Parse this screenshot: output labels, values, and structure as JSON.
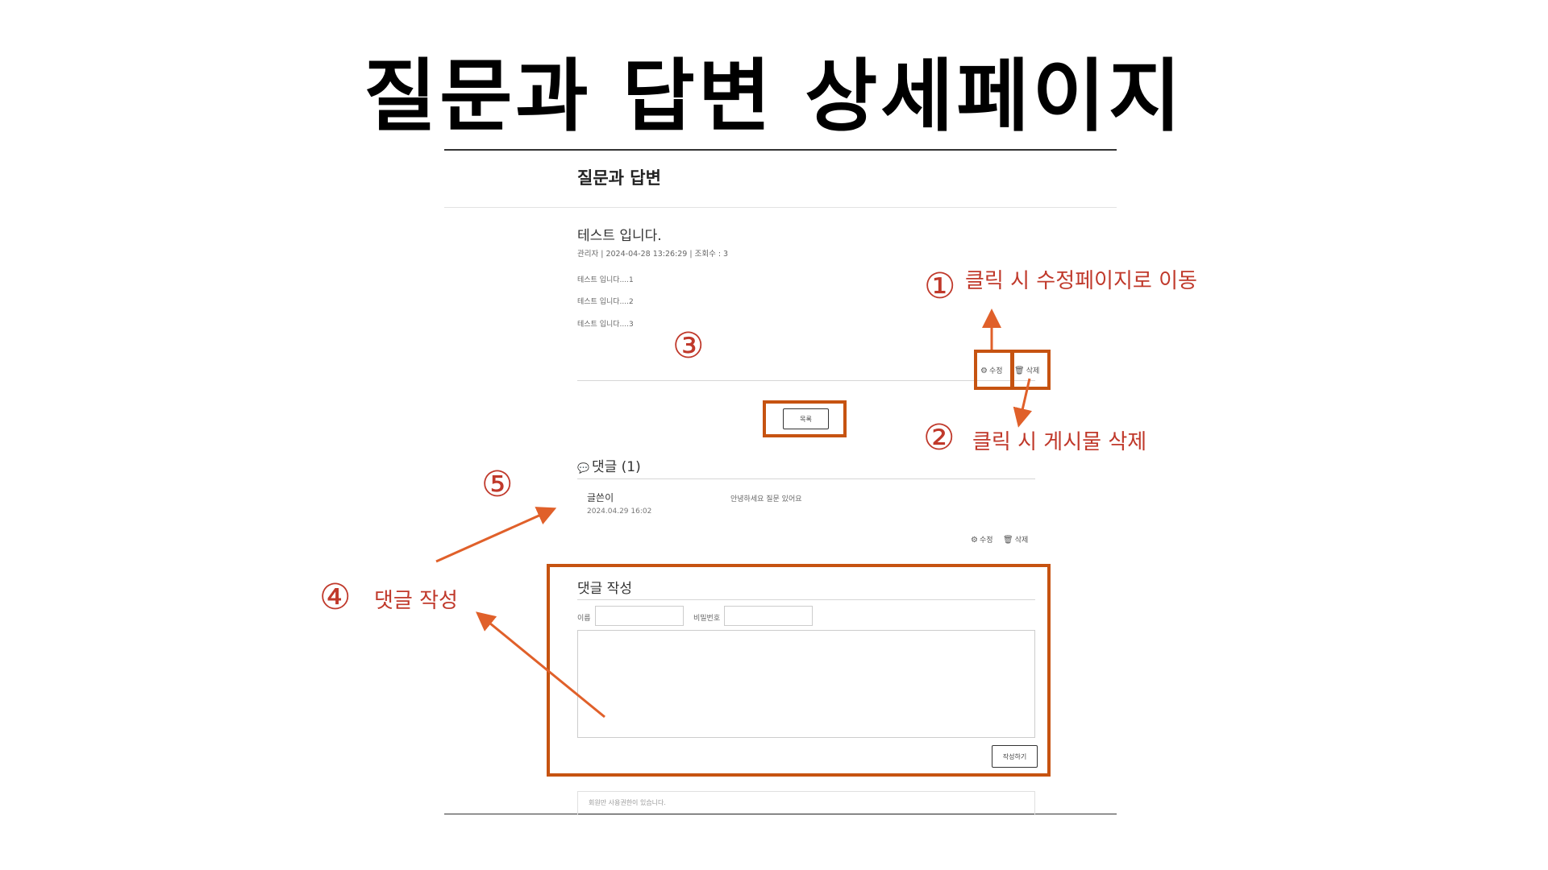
{
  "slide": {
    "title": "질문과 답변 상세페이지"
  },
  "page": {
    "board_title": "질문과 답변",
    "post": {
      "title": "테스트 입니다.",
      "meta": "관리자  |  2024-04-28 13:26:29  |  조회수 :   3",
      "lines": [
        "테스트 입니다....1",
        "테스트 입니다....2",
        "테스트 입니다....3"
      ]
    },
    "actions": {
      "edit_label": "수정",
      "delete_label": "삭제",
      "edit_icon": "gear-icon",
      "delete_icon": "trash-icon"
    },
    "list_button": "목록",
    "comments": {
      "heading": "댓글 (1)",
      "heading_icon": "speech-bubble-icon",
      "items": [
        {
          "author": "글쓴이",
          "date": "2024.04.29 16:02",
          "body": "안녕하세요 질문 있어요",
          "edit_label": "수정",
          "delete_label": "삭제"
        }
      ]
    },
    "comment_form": {
      "heading": "댓글 작성",
      "name_label": "이름",
      "password_label": "비밀번호",
      "submit_label": "작성하기"
    },
    "login_note": "회원만 사용권한이 있습니다."
  },
  "annotations": {
    "color": "#c0392b",
    "box_color": "#c65311",
    "items": [
      {
        "number": "①",
        "text": "클릭 시 수정페이지로 이동"
      },
      {
        "number": "②",
        "text": "클릭 시 게시물 삭제"
      },
      {
        "number": "③",
        "text": ""
      },
      {
        "number": "④",
        "text": "댓글 작성"
      },
      {
        "number": "⑤",
        "text": ""
      }
    ]
  }
}
